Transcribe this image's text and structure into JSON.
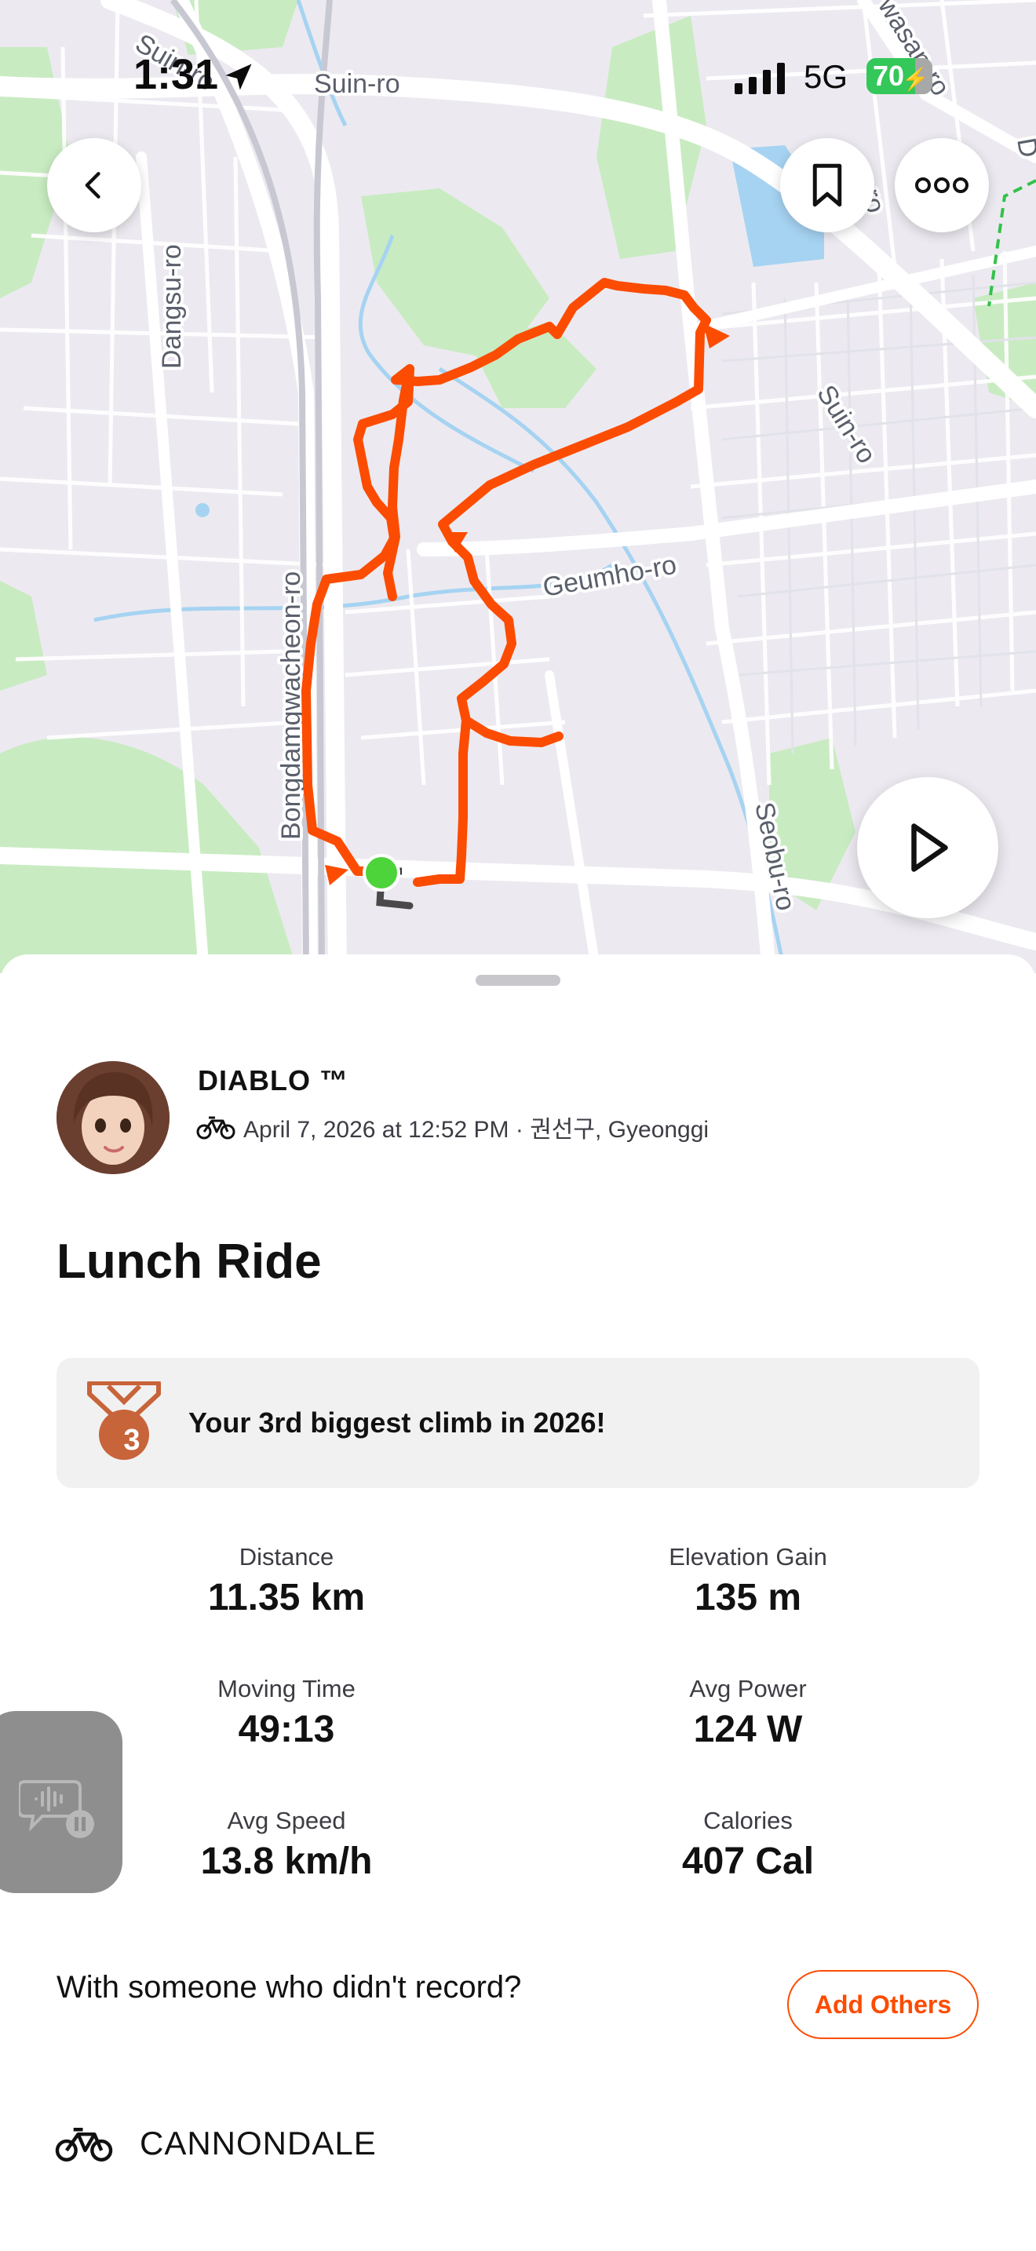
{
  "status_bar": {
    "time": "1:31",
    "network": "5G",
    "battery": "70"
  },
  "map": {
    "roads": {
      "suin_ro_top": "Suin-ro",
      "suin_ro_corner": "Suin-ro",
      "suin_ro_right": "Suin-ro",
      "dangsu_ro": "Dangsu-ro",
      "geumho_ro": "Geumho-ro",
      "bongdamgwacheon_ro": "Bongdamgwacheon-ro",
      "seobu_ro": "Seobu-ro",
      "wasan_ro": "wasan-ro",
      "edge_ro": "ro",
      "edge_d": "D"
    },
    "route_color": "#fc4c02",
    "start_color": "#4cd43a"
  },
  "activity": {
    "athlete_name": "DIABLO ™",
    "date_location": "April 7, 2026 at 12:52 PM · 권선구, Gyeonggi",
    "title": "Lunch Ride",
    "achievement": {
      "medal_number": "3",
      "text": "Your 3rd biggest climb in 2026!"
    },
    "stats": [
      {
        "label": "Distance",
        "value": "11.35 km"
      },
      {
        "label": "Elevation Gain",
        "value": "135 m"
      },
      {
        "label": "Moving Time",
        "value": "49:13"
      },
      {
        "label": "Avg Power",
        "value": "124 W"
      },
      {
        "label": "Avg Speed",
        "value": "13.8 km/h"
      },
      {
        "label": "Calories",
        "value": "407 Cal"
      }
    ],
    "others_prompt": "With someone who didn't record?",
    "add_others_label": "Add Others",
    "gear": "CANNONDALE"
  },
  "colors": {
    "accent": "#fc4c02",
    "sheet_bg": "#ffffff",
    "card_bg": "#f1f1f1"
  }
}
